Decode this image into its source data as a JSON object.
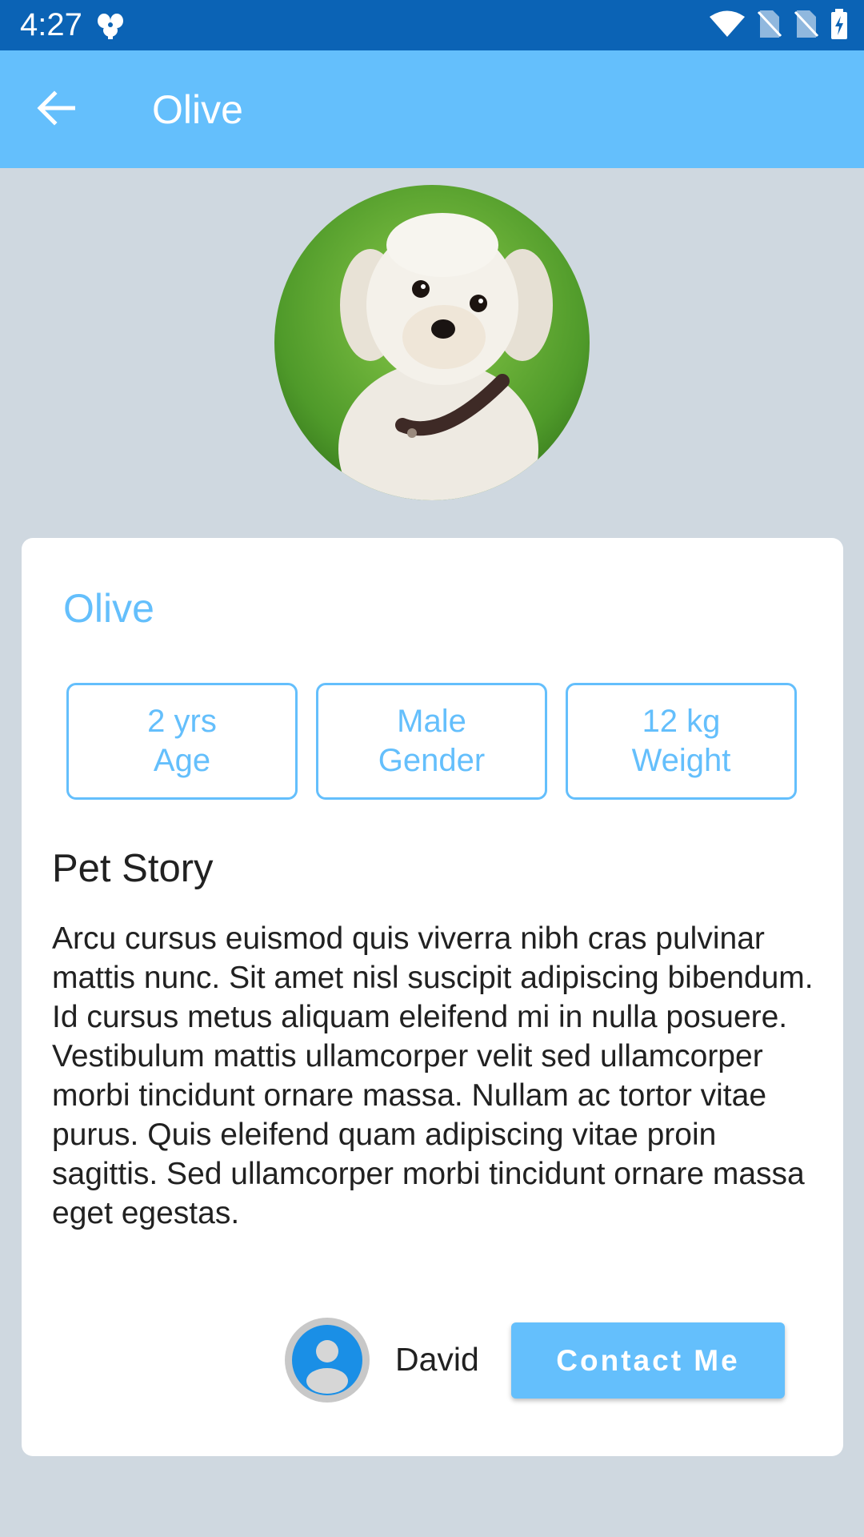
{
  "status_bar": {
    "time": "4:27",
    "icons": [
      "fan-icon",
      "wifi-icon",
      "no-sim-icon",
      "no-sim-icon",
      "battery-charging-icon"
    ]
  },
  "app_bar": {
    "title": "Olive",
    "back_icon": "arrow-back-icon"
  },
  "pet": {
    "name": "Olive",
    "photo": "white-dog-photo",
    "attributes": [
      {
        "value": "2 yrs",
        "label": "Age"
      },
      {
        "value": "Male",
        "label": "Gender"
      },
      {
        "value": "12 kg",
        "label": "Weight"
      }
    ],
    "story_heading": "Pet Story",
    "story": "Arcu cursus euismod quis viverra nibh cras pulvinar mattis nunc. Sit amet nisl suscipit adipiscing bibendum. Id cursus metus aliquam eleifend mi in nulla posuere. Vestibulum mattis ullamcorper velit sed ullamcorper morbi tincidunt ornare massa. Nullam ac tortor vitae purus. Quis eleifend quam adipiscing vitae proin sagittis. Sed ullamcorper morbi tincidunt ornare massa eget egestas."
  },
  "owner": {
    "name": "David",
    "avatar_icon": "account-circle-icon"
  },
  "contact_button": {
    "label": "Contact Me"
  },
  "colors": {
    "status_bar": "#0b63b5",
    "accent": "#64bffc",
    "background": "#cfd8e0",
    "card": "#ffffff",
    "text": "#212121"
  }
}
